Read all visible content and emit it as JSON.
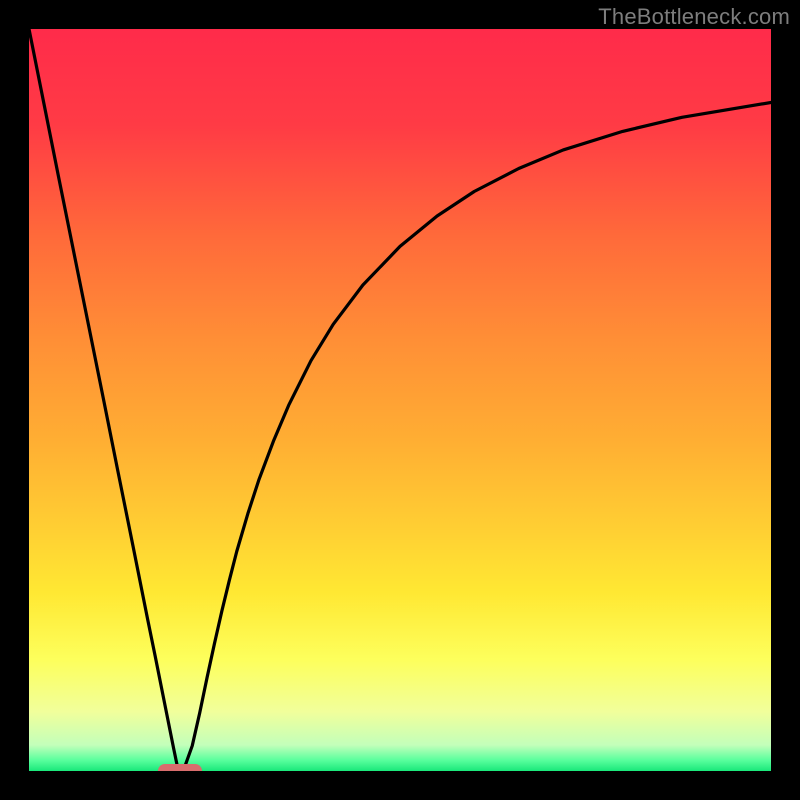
{
  "watermark": "TheBottleneck.com",
  "chart_data": {
    "type": "line",
    "title": "",
    "xlabel": "",
    "ylabel": "",
    "xlim": [
      0,
      100
    ],
    "ylim": [
      0,
      100
    ],
    "gradient_stops": [
      {
        "offset": 0.0,
        "color": "#ff2b4a"
      },
      {
        "offset": 0.13,
        "color": "#ff3b45"
      },
      {
        "offset": 0.28,
        "color": "#ff6a3a"
      },
      {
        "offset": 0.42,
        "color": "#ff8f36"
      },
      {
        "offset": 0.55,
        "color": "#ffad33"
      },
      {
        "offset": 0.66,
        "color": "#ffcb33"
      },
      {
        "offset": 0.76,
        "color": "#ffe833"
      },
      {
        "offset": 0.85,
        "color": "#fdff5c"
      },
      {
        "offset": 0.92,
        "color": "#f1ff9b"
      },
      {
        "offset": 0.965,
        "color": "#c3ffba"
      },
      {
        "offset": 0.985,
        "color": "#5bff9e"
      },
      {
        "offset": 1.0,
        "color": "#19e87a"
      }
    ],
    "series": [
      {
        "name": "bottleneck-curve",
        "x": [
          0.0,
          2.0,
          4.0,
          6.0,
          8.0,
          10.0,
          12.0,
          14.0,
          16.0,
          17.0,
          18.0,
          19.0,
          19.5,
          20.0,
          20.5,
          21.0,
          22.0,
          23.0,
          24.0,
          25.0,
          26.0,
          27.0,
          28.0,
          29.5,
          31.0,
          33.0,
          35.0,
          38.0,
          41.0,
          45.0,
          50.0,
          55.0,
          60.0,
          66.0,
          72.0,
          80.0,
          88.0,
          100.0
        ],
        "y": [
          100.0,
          90.0,
          80.0,
          70.1,
          60.2,
          50.3,
          40.3,
          30.4,
          20.4,
          15.5,
          10.5,
          5.5,
          3.0,
          0.6,
          0.0,
          0.6,
          3.4,
          7.8,
          12.6,
          17.2,
          21.6,
          25.7,
          29.6,
          34.7,
          39.3,
          44.6,
          49.3,
          55.3,
          60.2,
          65.5,
          70.7,
          74.8,
          78.1,
          81.2,
          83.7,
          86.2,
          88.1,
          90.1
        ]
      }
    ],
    "marker": {
      "x": 20.3,
      "y": 0.0,
      "color": "#d96d6d"
    }
  }
}
